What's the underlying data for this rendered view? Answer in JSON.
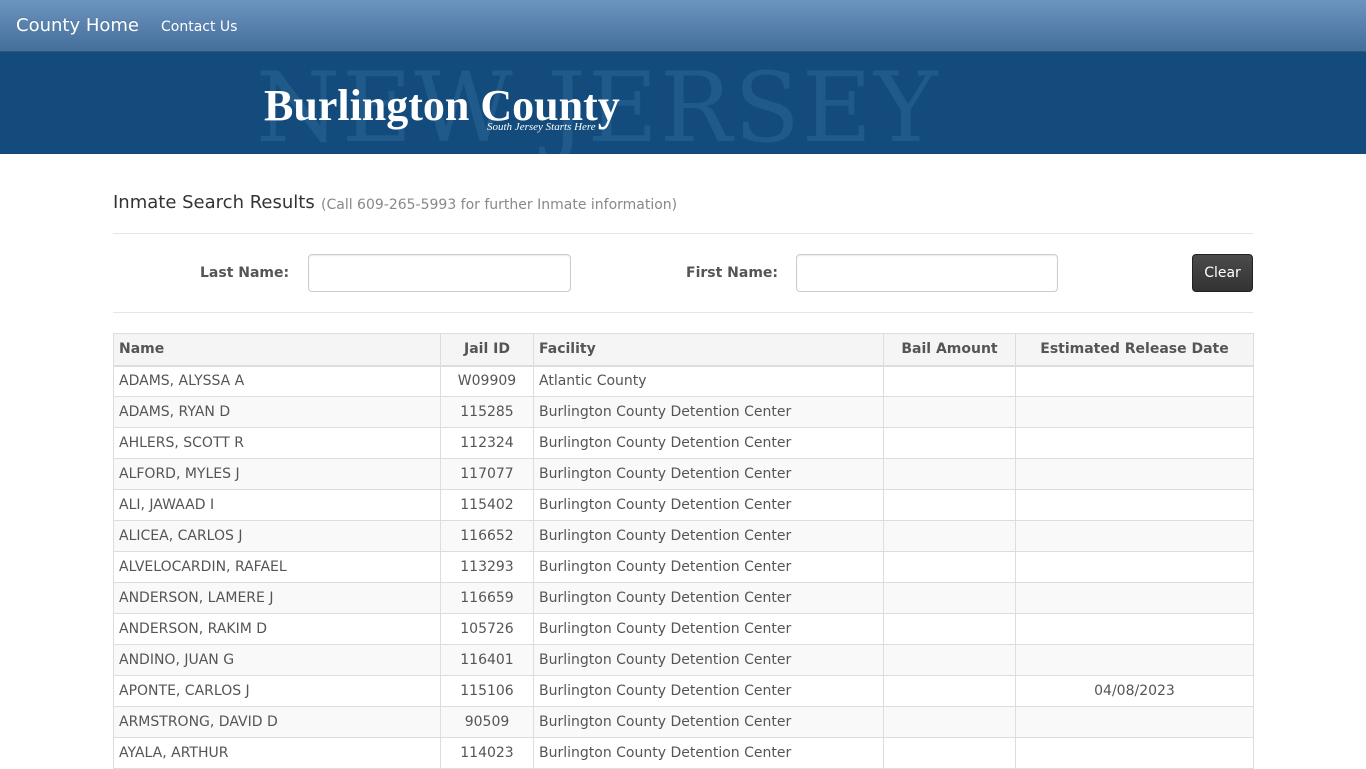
{
  "nav": {
    "brand": "County Home",
    "links": [
      "Contact Us"
    ]
  },
  "banner": {
    "background_text": "NEW JERSEY",
    "title": "Burlington County",
    "tagline": "South Jersey Starts Here"
  },
  "results": {
    "heading": "Inmate Search Results",
    "note": "(Call 609-265-5993 for further Inmate information)"
  },
  "search": {
    "last_name_label": "Last Name:",
    "last_name_value": "",
    "first_name_label": "First Name:",
    "first_name_value": "",
    "clear_label": "Clear"
  },
  "table": {
    "headers": [
      "Name",
      "Jail ID",
      "Facility",
      "Bail Amount",
      "Estimated Release Date"
    ],
    "rows": [
      [
        "ADAMS, ALYSSA  A",
        "W09909",
        "Atlantic County",
        "",
        ""
      ],
      [
        "ADAMS, RYAN  D",
        "115285",
        "Burlington County Detention Center",
        "",
        ""
      ],
      [
        "AHLERS, SCOTT  R",
        "112324",
        "Burlington County Detention Center",
        "",
        ""
      ],
      [
        "ALFORD, MYLES  J",
        "117077",
        "Burlington County Detention Center",
        "",
        ""
      ],
      [
        "ALI, JAWAAD  I",
        "115402",
        "Burlington County Detention Center",
        "",
        ""
      ],
      [
        "ALICEA, CARLOS  J",
        "116652",
        "Burlington County Detention Center",
        "",
        ""
      ],
      [
        "ALVELOCARDIN, RAFAEL",
        "113293",
        "Burlington County Detention Center",
        "",
        ""
      ],
      [
        "ANDERSON, LAMERE  J",
        "116659",
        "Burlington County Detention Center",
        "",
        ""
      ],
      [
        "ANDERSON, RAKIM  D",
        "105726",
        "Burlington County Detention Center",
        "",
        ""
      ],
      [
        "ANDINO, JUAN  G",
        "116401",
        "Burlington County Detention Center",
        "",
        ""
      ],
      [
        "APONTE, CARLOS  J",
        "115106",
        "Burlington County Detention Center",
        "",
        "04/08/2023"
      ],
      [
        "ARMSTRONG, DAVID  D",
        "90509",
        "Burlington County Detention Center",
        "",
        ""
      ],
      [
        "AYALA, ARTHUR",
        "114023",
        "Burlington County Detention Center",
        "",
        ""
      ]
    ]
  }
}
